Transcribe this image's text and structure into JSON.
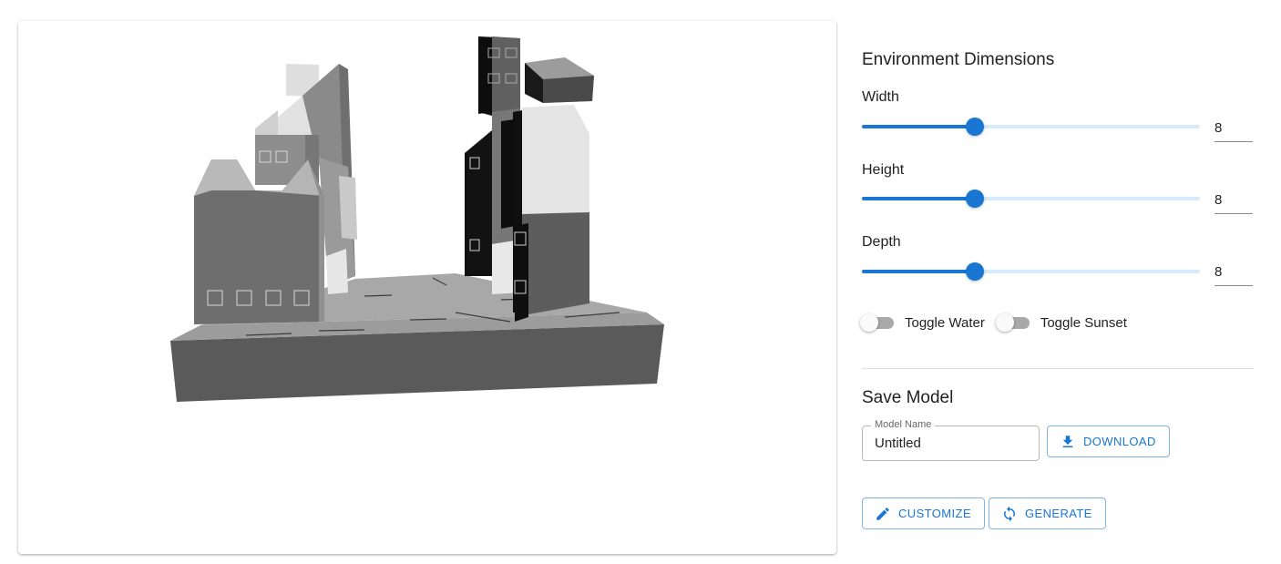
{
  "scene": {
    "name": "3D city environment preview"
  },
  "panel": {
    "dimensions_title": "Environment Dimensions",
    "sliders": [
      {
        "label": "Width",
        "value": "8",
        "fraction": 0.333
      },
      {
        "label": "Height",
        "value": "8",
        "fraction": 0.333
      },
      {
        "label": "Depth",
        "value": "8",
        "fraction": 0.333
      }
    ],
    "toggles": [
      {
        "label": "Toggle Water",
        "checked": false
      },
      {
        "label": "Toggle Sunset",
        "checked": false
      }
    ],
    "save_title": "Save Model",
    "model_name": {
      "label": "Model Name",
      "value": "Untitled"
    },
    "buttons": {
      "download": "DOWNLOAD",
      "customize": "CUSTOMIZE",
      "generate": "GENERATE"
    }
  },
  "icons": {
    "download": "download-icon",
    "customize": "pencil-icon",
    "generate": "refresh-icon"
  },
  "colors": {
    "accent": "#1976d2",
    "accent_light": "#90caf9",
    "switch_track": "#a9a9a9",
    "divider": "#e0e0e0"
  }
}
